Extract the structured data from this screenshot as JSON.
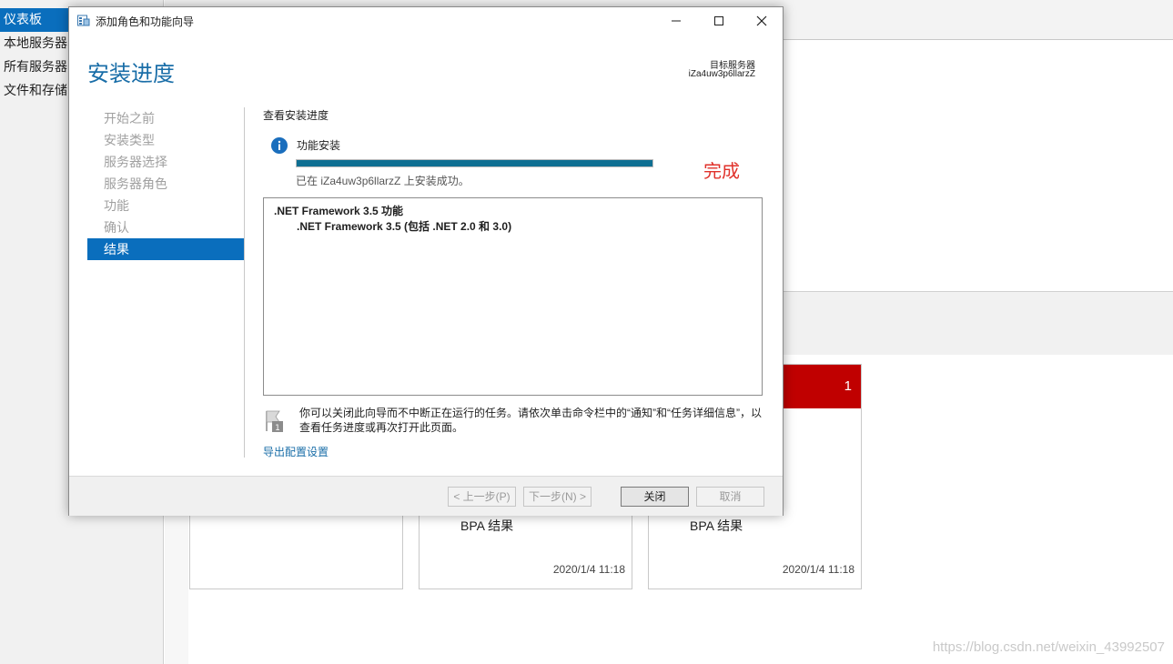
{
  "server_manager": {
    "sidebar": {
      "items": [
        {
          "label": "仪表板",
          "active": true
        },
        {
          "label": "本地服务器"
        },
        {
          "label": "所有服务器"
        },
        {
          "label": "文件和存储"
        }
      ]
    },
    "tiles": [
      {
        "bpa": "",
        "time": ""
      },
      {
        "bpa": "BPA 结果",
        "time": "2020/1/4 11:18"
      },
      {
        "bpa": "BPA 结果",
        "time": "2020/1/4 11:18",
        "count": "1"
      }
    ],
    "watermark": "https://blog.csdn.net/weixin_43992507"
  },
  "wizard": {
    "title": "添加角色和功能向导",
    "page_title": "安装进度",
    "target_label": "目标服务器",
    "target_server": "iZa4uw3p6llarzZ",
    "steps": [
      {
        "label": "开始之前"
      },
      {
        "label": "安装类型"
      },
      {
        "label": "服务器选择"
      },
      {
        "label": "服务器角色"
      },
      {
        "label": "功能"
      },
      {
        "label": "确认"
      },
      {
        "label": "结果",
        "active": true
      }
    ],
    "section_title": "查看安装进度",
    "feature_install_label": "功能安装",
    "progress_fraction": 1.0,
    "complete_annotation": "完成",
    "success_text": "已在 iZa4uw3p6llarzZ 上安装成功。",
    "results": {
      "feature": ".NET Framework 3.5 功能",
      "sub_feature": ".NET Framework 3.5 (包括 .NET 2.0 和 3.0)"
    },
    "note": "你可以关闭此向导而不中断正在运行的任务。请依次单击命令栏中的“通知”和“任务详细信息”，以查看任务进度或再次打开此页面。",
    "export_link": "导出配置设置",
    "buttons": {
      "previous": "< 上一步(P)",
      "next": "下一步(N) >",
      "close": "关闭",
      "cancel": "取消"
    },
    "colors": {
      "accent": "#0a6ebd",
      "title_blue": "#1a6ea8",
      "progress": "#0e6f92",
      "annotation_red": "#e0312a",
      "tile_red": "#c00000"
    }
  }
}
